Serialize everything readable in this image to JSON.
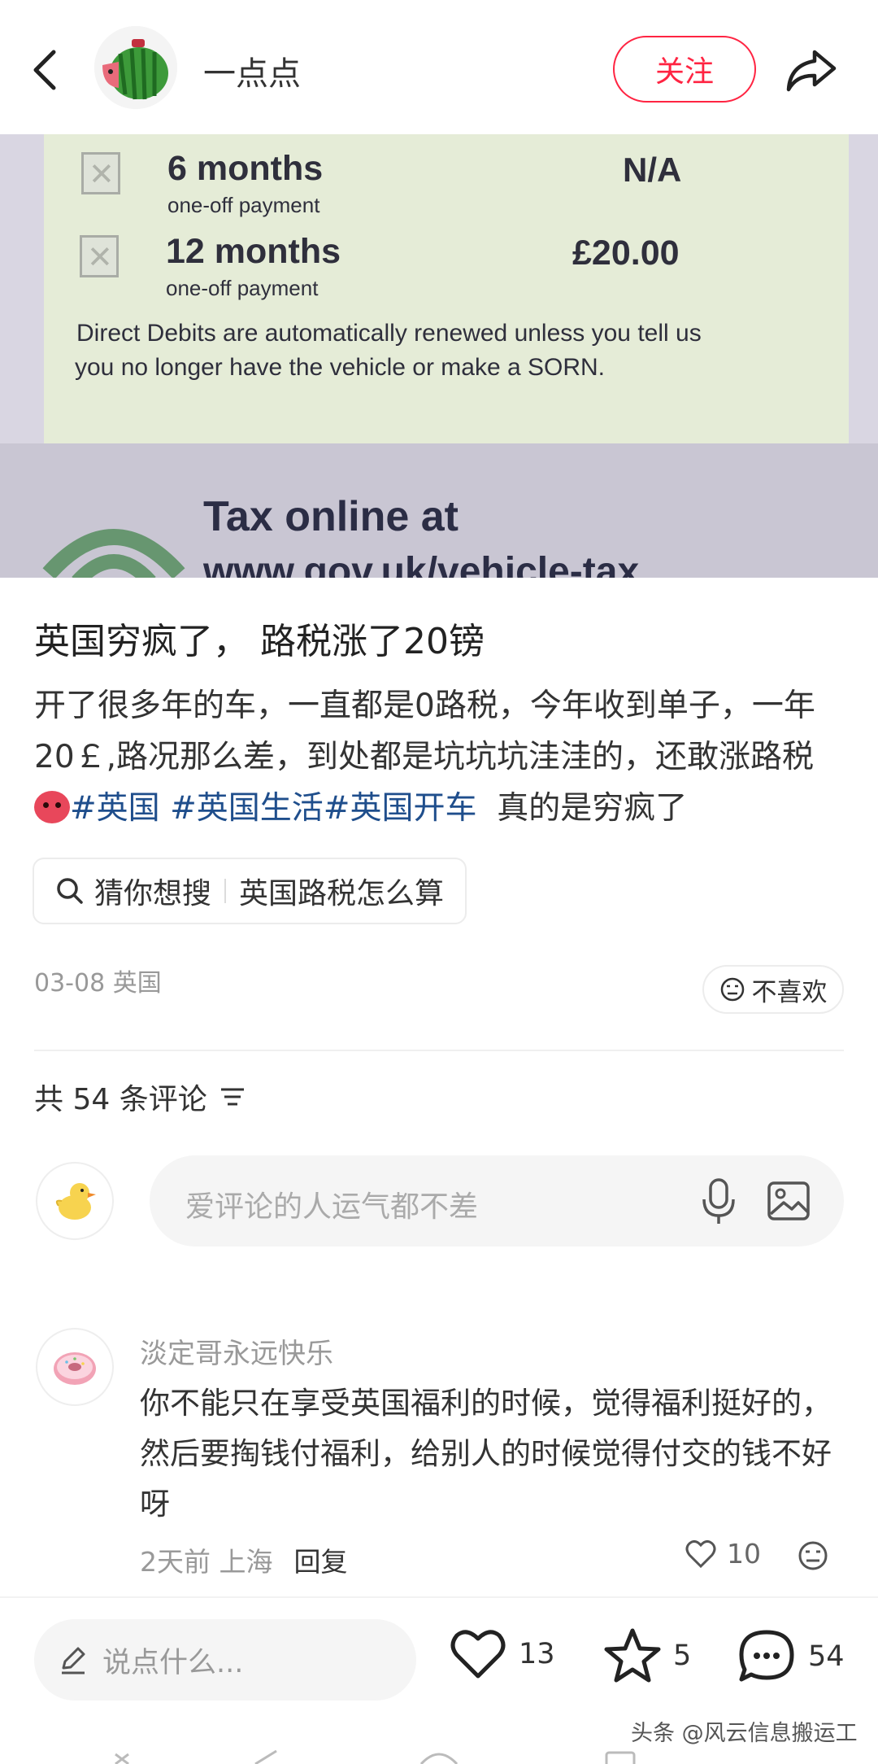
{
  "header": {
    "author_name": "一点点",
    "follow_label": "关注"
  },
  "photo": {
    "row1_term": "6 months",
    "row1_sub": "one-off payment",
    "row1_price": "N/A",
    "row2_term": "12 months",
    "row2_sub": "one-off payment",
    "row2_price": "£20.00",
    "notice_line1": "Direct Debits are automatically renewed unless you tell us",
    "notice_line2": "you no longer have the vehicle or make a SORN.",
    "tax_heading": "Tax online at",
    "tax_url": "www.gov.uk/vehicle-tax"
  },
  "post": {
    "title": "英国穷疯了， 路税涨了20镑",
    "body_text": "开了很多年的车，一直都是0路税，今年收到单子，一年20￡,路况那么差，到处都是坑坑坑洼洼的，还敢涨路税",
    "hashtag1": "#英国",
    "hashtag2": "#英国生活",
    "hashtag3": "#英国开车",
    "body_tail": "真的是穷疯了",
    "suggest_prefix": "猜你想搜",
    "suggest_query": "英国路税怎么算",
    "meta": "03-08 英国",
    "dislike_label": "不喜欢"
  },
  "comments": {
    "count_label": "共 54 条评论",
    "input_placeholder": "爱评论的人运气都不差",
    "items": [
      {
        "name": "淡定哥永远快乐",
        "text": "你不能只在享受英国福利的时候，觉得福利挺好的，然后要掏钱付福利，给别人的时候觉得付交的钱不好呀",
        "time_location": "2天前 上海",
        "reply_label": "回复",
        "likes": "10"
      }
    ]
  },
  "bottom_bar": {
    "say_placeholder": "说点什么...",
    "likes": "13",
    "stars": "5",
    "comments": "54"
  },
  "watermark": "头条 @风云信息搬运工",
  "colors": {
    "accent": "#ff2442",
    "hashtag": "#1f4e8c"
  }
}
